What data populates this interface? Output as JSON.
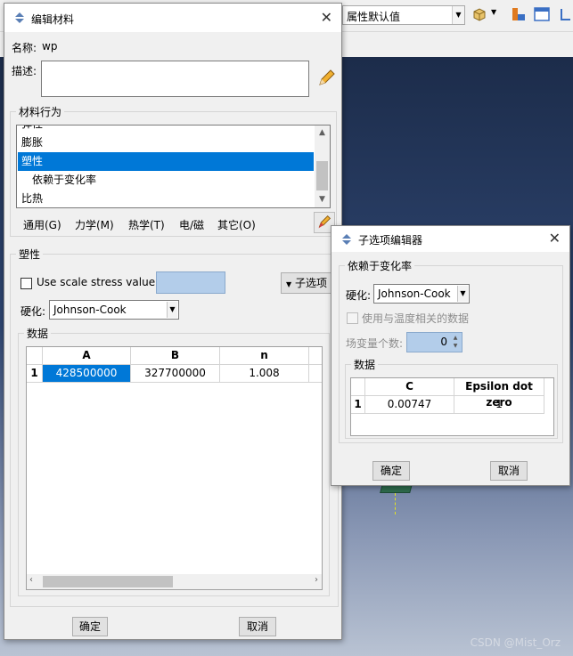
{
  "background": {
    "property_select": "属性默认值",
    "watermark": "CSDN @Mist_Orz"
  },
  "main_dialog": {
    "title": "编辑材料",
    "name_label": "名称:",
    "name_value": "wp",
    "desc_label": "描述:",
    "desc_value": "",
    "behaviors_label": "材料行为",
    "behaviors": [
      {
        "label": "弹性",
        "indent": false,
        "selected": false
      },
      {
        "label": "膨胀",
        "indent": false,
        "selected": false
      },
      {
        "label": "塑性",
        "indent": false,
        "selected": true
      },
      {
        "label": "依赖于变化率",
        "indent": true,
        "selected": false
      },
      {
        "label": "比热",
        "indent": false,
        "selected": false
      }
    ],
    "menus": [
      "通用(G)",
      "力学(M)",
      "热学(T)",
      "电/磁",
      "其它(O)"
    ],
    "section_title": "塑性",
    "scale_checkbox_label": "Use scale stress value:",
    "scale_checked": false,
    "suboptions_label": "子选项",
    "hardening_label": "硬化:",
    "hardening_value": "Johnson-Cook",
    "data_label": "数据",
    "table": {
      "columns": [
        "A",
        "B",
        "n"
      ],
      "rows": [
        {
          "index": "1",
          "cells": [
            "428500000",
            "327700000",
            "1.008"
          ]
        }
      ]
    },
    "ok_label": "确定",
    "cancel_label": "取消"
  },
  "sub_dialog": {
    "title": "子选项编辑器",
    "section_title": "依赖于变化率",
    "hardening_label": "硬化:",
    "hardening_value": "Johnson-Cook",
    "temp_checkbox_label": "使用与温度相关的数据",
    "field_label": "场变量个数:",
    "field_value": "0",
    "data_label": "数据",
    "table": {
      "columns": [
        "C",
        "Epsilon dot zero"
      ],
      "rows": [
        {
          "index": "1",
          "cells": [
            "0.00747",
            "1"
          ]
        }
      ]
    },
    "ok_label": "确定",
    "cancel_label": "取消"
  },
  "colors": {
    "selection": "#0078d7",
    "field_highlight": "#b3cdea"
  }
}
